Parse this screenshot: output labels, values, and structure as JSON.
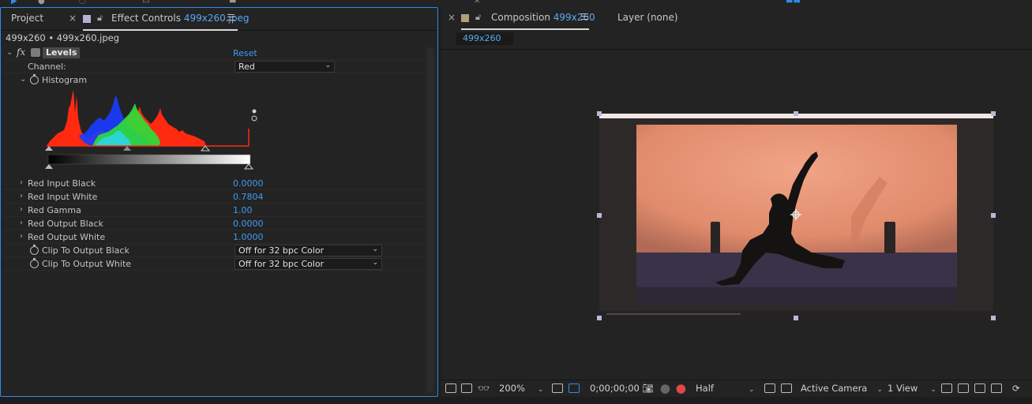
{
  "left_panel": {
    "tabs": {
      "project": "Project",
      "effect_controls_prefix": "Effect Controls",
      "effect_controls_file": "499x260.jpeg"
    },
    "subheader": "499x260 • 499x260.jpeg",
    "effect": {
      "fx_mark": "fx",
      "name": "Levels",
      "reset": "Reset",
      "channel_label": "Channel:",
      "channel_value": "Red",
      "histogram_label": "Histogram",
      "params": [
        {
          "label": "Red Input Black",
          "value": "0.0000"
        },
        {
          "label": "Red Input White",
          "value": "0.7804"
        },
        {
          "label": "Red Gamma",
          "value": "1.00"
        },
        {
          "label": "Red Output Black",
          "value": "0.0000"
        },
        {
          "label": "Red Output White",
          "value": "1.0000"
        }
      ],
      "clip_black_label": "Clip To Output Black",
      "clip_black_value": "Off for 32 bpc Color",
      "clip_white_label": "Clip To Output White",
      "clip_white_value": "Off for 32 bpc Color"
    }
  },
  "right_panel": {
    "tabs": {
      "composition_prefix": "Composition",
      "composition_name": "499x260",
      "layer": "Layer (none)"
    },
    "comp_chip": "499x260",
    "bottom_bar": {
      "zoom": "200%",
      "timecode": "0;00;00;00",
      "resolution": "Half",
      "camera": "Active Camera",
      "views": "1 View"
    }
  },
  "colors": {
    "accent": "#2d8ceb",
    "value_blue": "#3f9cf2",
    "panel_bg": "#232323",
    "histogram_red": "#ff2a10",
    "histogram_green": "#2fdc3a",
    "histogram_blue": "#1a3cff",
    "wall": "#e8977a",
    "floor": "#3a3248"
  }
}
